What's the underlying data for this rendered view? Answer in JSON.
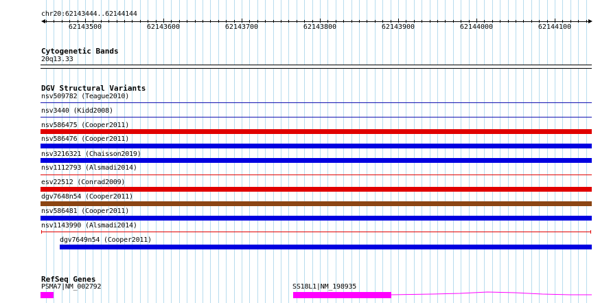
{
  "ruler": {
    "coordinates": "chr20:62143444..62144144",
    "tick_labels": [
      "62143500",
      "62143600",
      "62143700",
      "62143800",
      "62143900",
      "62144000",
      "62144100"
    ]
  },
  "cytoband_track": {
    "title": "Cytogenetic Bands",
    "band_label": "20q13.33"
  },
  "dgv_track": {
    "title": "DGV Structural Variants",
    "features": [
      {
        "label": "nsv509782 (Teague2010)",
        "color": "#1010b0",
        "style": "thin"
      },
      {
        "label": "nsv3440 (Kidd2008)",
        "color": "#1010b0",
        "style": "thin"
      },
      {
        "label": "nsv586475 (Cooper2011)",
        "color": "#e00000",
        "style": "thick"
      },
      {
        "label": "nsv586476 (Cooper2011)",
        "color": "#0000e0",
        "style": "thick"
      },
      {
        "label": "nsv3216321 (Chaisson2019)",
        "color": "#0000e0",
        "style": "thick"
      },
      {
        "label": "nsv1112793 (Alsmadi2014)",
        "color": "#e00000",
        "style": "thin"
      },
      {
        "label": "esv22512 (Conrad2009)",
        "color": "#e00000",
        "style": "thick"
      },
      {
        "label": "dgv7648n54 (Cooper2011)",
        "color": "#8b4513",
        "style": "thick"
      },
      {
        "label": "nsv586481 (Cooper2011)",
        "color": "#0000e0",
        "style": "thick"
      },
      {
        "label": "nsv1143990 (Alsmadi2014)",
        "color": "#e00000",
        "style": "capped"
      },
      {
        "label": "dgv7649n54 (Cooper2011)",
        "color": "#0000e0",
        "style": "thick-indented"
      }
    ]
  },
  "refseq_track": {
    "title": "RefSeq Genes",
    "genes": [
      {
        "label": "PSMA7|NM_002792",
        "color": "#ff00ff"
      },
      {
        "label": "SS18L1|NM_198935",
        "color": "#ff00ff"
      }
    ]
  }
}
